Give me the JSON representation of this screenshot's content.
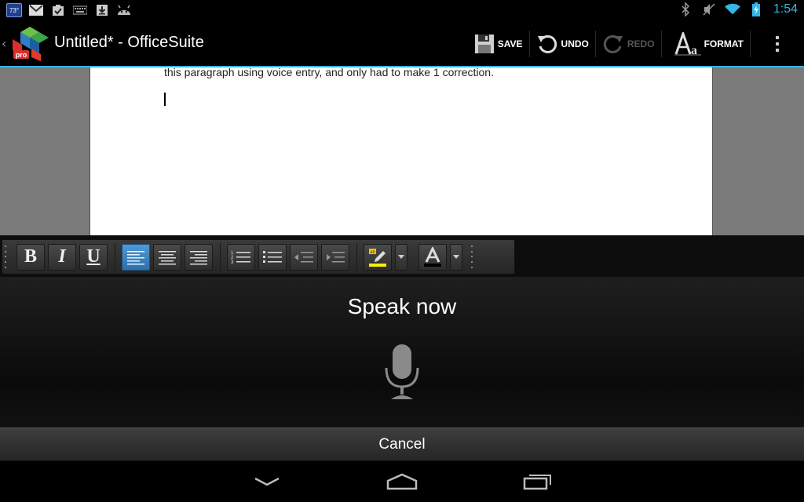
{
  "status_bar": {
    "temperature": "73°",
    "time": "1:54",
    "left_icons": [
      "gmail-icon",
      "task-check-icon",
      "keyboard-icon",
      "download-icon",
      "android-icon"
    ],
    "right_icons": [
      "bluetooth-icon",
      "mute-icon",
      "wifi-icon",
      "battery-charging-icon"
    ],
    "accent_color": "#33b5e5"
  },
  "action_bar": {
    "title": "Untitled* - OfficeSuite",
    "logo_badge": "pro",
    "save_label": "SAVE",
    "undo_label": "UNDO",
    "redo_label": "REDO",
    "format_label": "FORMAT"
  },
  "document": {
    "text": "this paragraph using voice entry, and only had to make 1 correction."
  },
  "format_toolbar": {
    "bold": "B",
    "italic": "I",
    "underline": "U",
    "highlight_color": "#ffee00",
    "font_color": "#000000",
    "active_alignment": "left"
  },
  "voice": {
    "prompt": "Speak now",
    "cancel_label": "Cancel"
  },
  "nav_bar": {
    "icons": [
      "back-icon",
      "home-icon",
      "recent-apps-icon"
    ]
  }
}
